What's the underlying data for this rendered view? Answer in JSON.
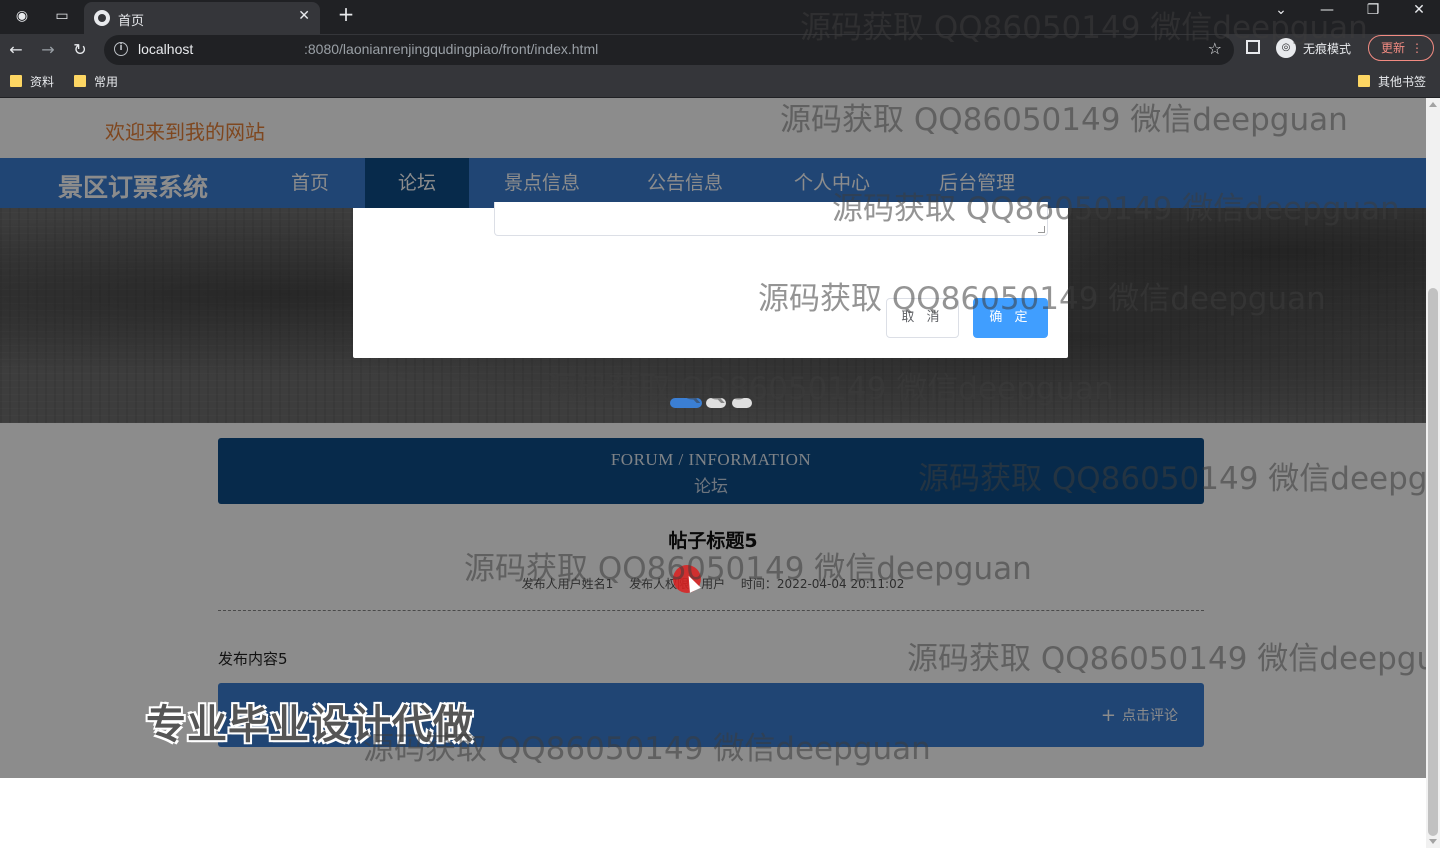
{
  "browser": {
    "tab_title": "首页",
    "tab_close": "✕",
    "new_tab": "+",
    "url_host": "localhost",
    "url_path": ":8080/laonianrenjingqudingpiao/front/index.html",
    "incognito_label": "无痕模式",
    "update_label": "更新",
    "bookmarks": [
      "资料",
      "常用"
    ],
    "other_bookmarks": "其他书签",
    "window_controls": [
      "⌄",
      "—",
      "❐",
      "✕"
    ]
  },
  "site": {
    "welcome": "欢迎来到我的网站",
    "brand": "景区订票系统",
    "nav": [
      "首页",
      "论坛",
      "景点信息",
      "公告信息",
      "个人中心",
      "后台管理"
    ],
    "active_nav": "论坛"
  },
  "modal": {
    "cancel_label": "取 消",
    "ok_label": "确 定"
  },
  "forum": {
    "header_en": "FORUM / INFORMATION",
    "header_zh": "论坛",
    "post_title": "帖子标题5",
    "meta_author": "发布人用户姓名1",
    "meta_role": "发布人权限：用户",
    "meta_time": "时间：2022-04-04 20:11:02",
    "body": "发布内容5",
    "comment_label": "点击评论"
  },
  "overlay": {
    "promo": "专业毕业设计代做",
    "watermark": "源码获取 QQ86050149 微信deepguan"
  },
  "colors": {
    "nav_blue": "#3b7fd4",
    "nav_active": "#0d4e89",
    "primary_button": "#409eff",
    "welcome_orange": "#e8823a"
  }
}
